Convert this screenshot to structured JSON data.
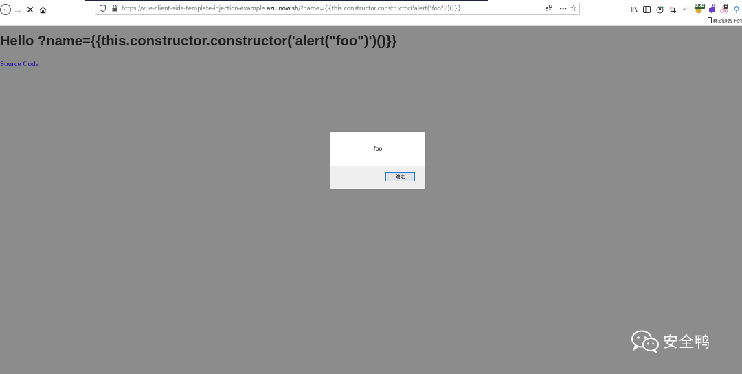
{
  "browser": {
    "url_prefix": "https://vue-client-side-template-injection-example.",
    "url_domain": "azu.now.sh",
    "url_suffix": "/?name={{this.constructor.constructor('alert(\"foo\")')()}}",
    "extensions": {
      "badge_1": "BUB",
      "badge_2": "1",
      "badge_3": "2"
    },
    "bookmark_label": "移动设备上的"
  },
  "page": {
    "heading": "Hello ?name={{this.constructor.constructor('alert(\"foo\")')()}}",
    "source_link": "Source Code"
  },
  "alert": {
    "message": "foo",
    "ok_label": "确定"
  },
  "watermark": {
    "text": "安全鸭"
  },
  "colors": {
    "page_overlay": "#8c8c8c",
    "link": "#1a0dab",
    "dialog_button_border": "#2a7bd3"
  }
}
